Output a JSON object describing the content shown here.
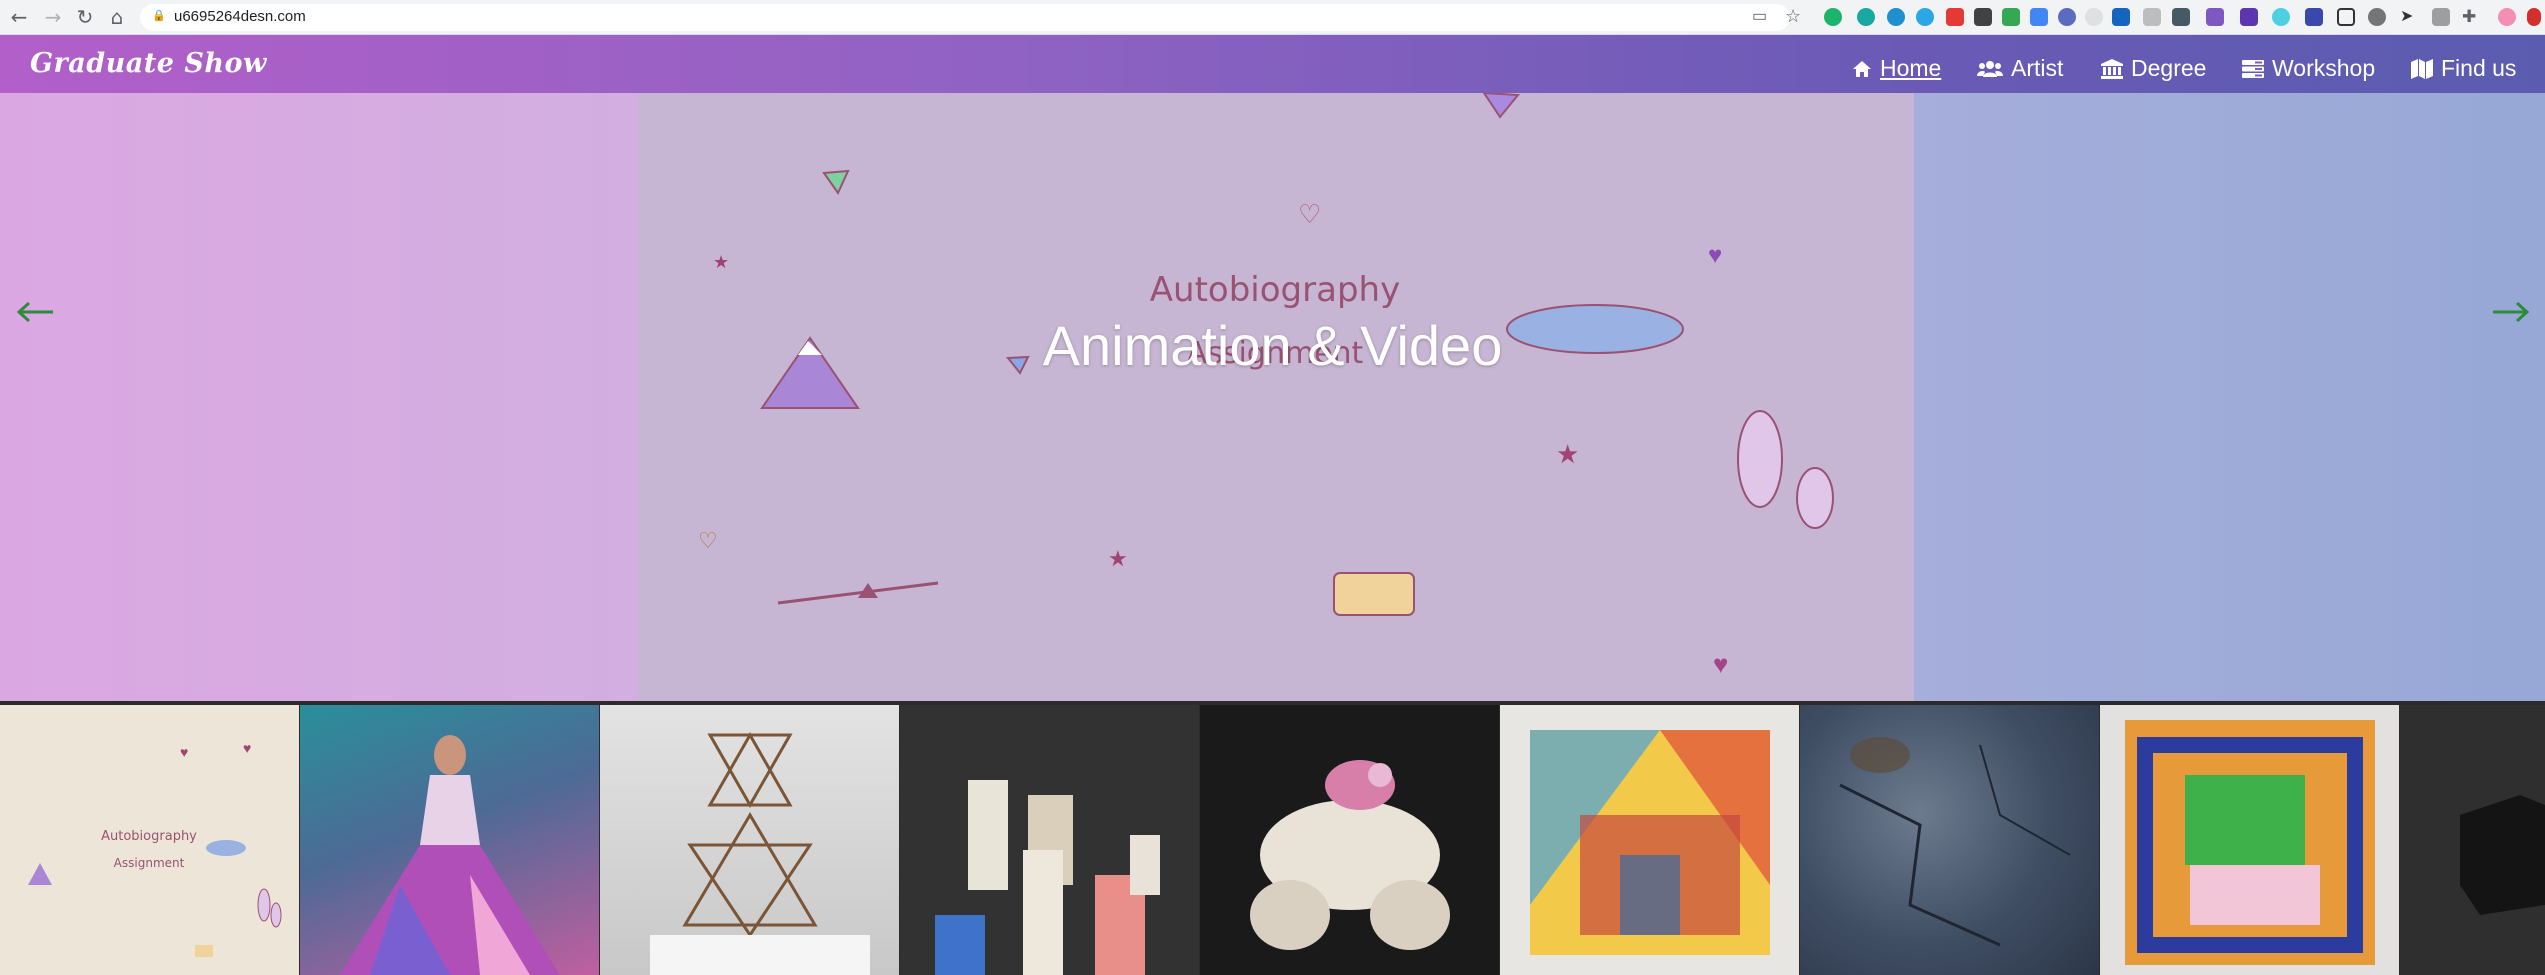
{
  "browser": {
    "url": "u6695264desn.com",
    "back_icon": "arrow-left-icon",
    "forward_icon": "arrow-right-icon",
    "reload_icon": "reload-icon",
    "home_icon": "home-icon"
  },
  "navbar": {
    "brand": "Graduate Show",
    "items": [
      {
        "label": "Home",
        "icon": "home-icon",
        "active": true
      },
      {
        "label": "Artist",
        "icon": "users-icon",
        "active": false
      },
      {
        "label": "Degree",
        "icon": "university-icon",
        "active": false
      },
      {
        "label": "Workshop",
        "icon": "tools-icon",
        "active": false
      },
      {
        "label": "Find us",
        "icon": "map-icon",
        "active": false
      }
    ]
  },
  "hero": {
    "title": "Animation & Video",
    "image_text_line1": "Autobiography",
    "image_text_line2": "Assignment",
    "prev_icon": "arrow-left-icon",
    "next_icon": "arrow-right-icon",
    "arrow_color": "#2e8b3a"
  },
  "thumbnails": {
    "items": [
      {
        "name": "autobiography-thumb",
        "text1": "Autobiography",
        "text2": "Assignment"
      },
      {
        "name": "fashion-dress-thumb"
      },
      {
        "name": "wire-sculpture-thumb"
      },
      {
        "name": "ceramic-blocks-thumb"
      },
      {
        "name": "skull-sculpture-thumb"
      },
      {
        "name": "color-glass-thumb"
      },
      {
        "name": "stone-texture-thumb"
      },
      {
        "name": "textile-weave-thumb"
      },
      {
        "name": "dark-object-thumb"
      }
    ]
  }
}
